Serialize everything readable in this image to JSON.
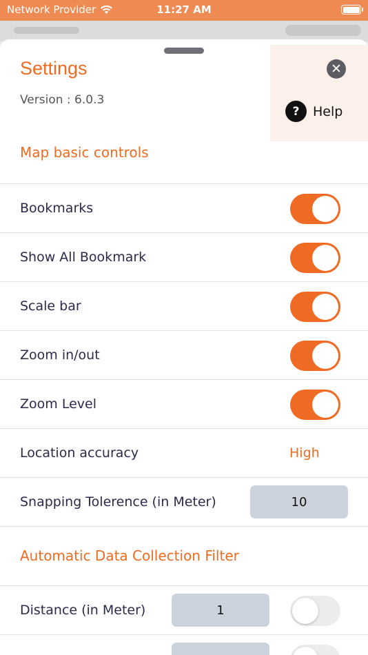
{
  "status": {
    "carrier": "Network Provider",
    "time": "11:27 AM"
  },
  "settings": {
    "title": "Settings",
    "version": "Version : 6.0.3",
    "help_label": "Help",
    "section_map": "Map basic controls",
    "section_auto": "Automatic Data Collection Filter",
    "toggles": [
      {
        "label": "Bookmarks",
        "on": true
      },
      {
        "label": "Show All Bookmark",
        "on": true
      },
      {
        "label": "Scale bar",
        "on": true
      },
      {
        "label": "Zoom in/out",
        "on": true
      },
      {
        "label": "Zoom Level",
        "on": true
      }
    ],
    "location_accuracy": {
      "label": "Location accuracy",
      "value": "High"
    },
    "snapping": {
      "label": "Snapping Tolerence (in Meter)",
      "value": "10"
    },
    "distance": {
      "label": "Distance (in Meter)",
      "value": "1",
      "on": false
    }
  },
  "colors": {
    "accent": "#ee6b22",
    "status_bar": "#ef8a53",
    "field_bg": "#cdd3dc"
  }
}
